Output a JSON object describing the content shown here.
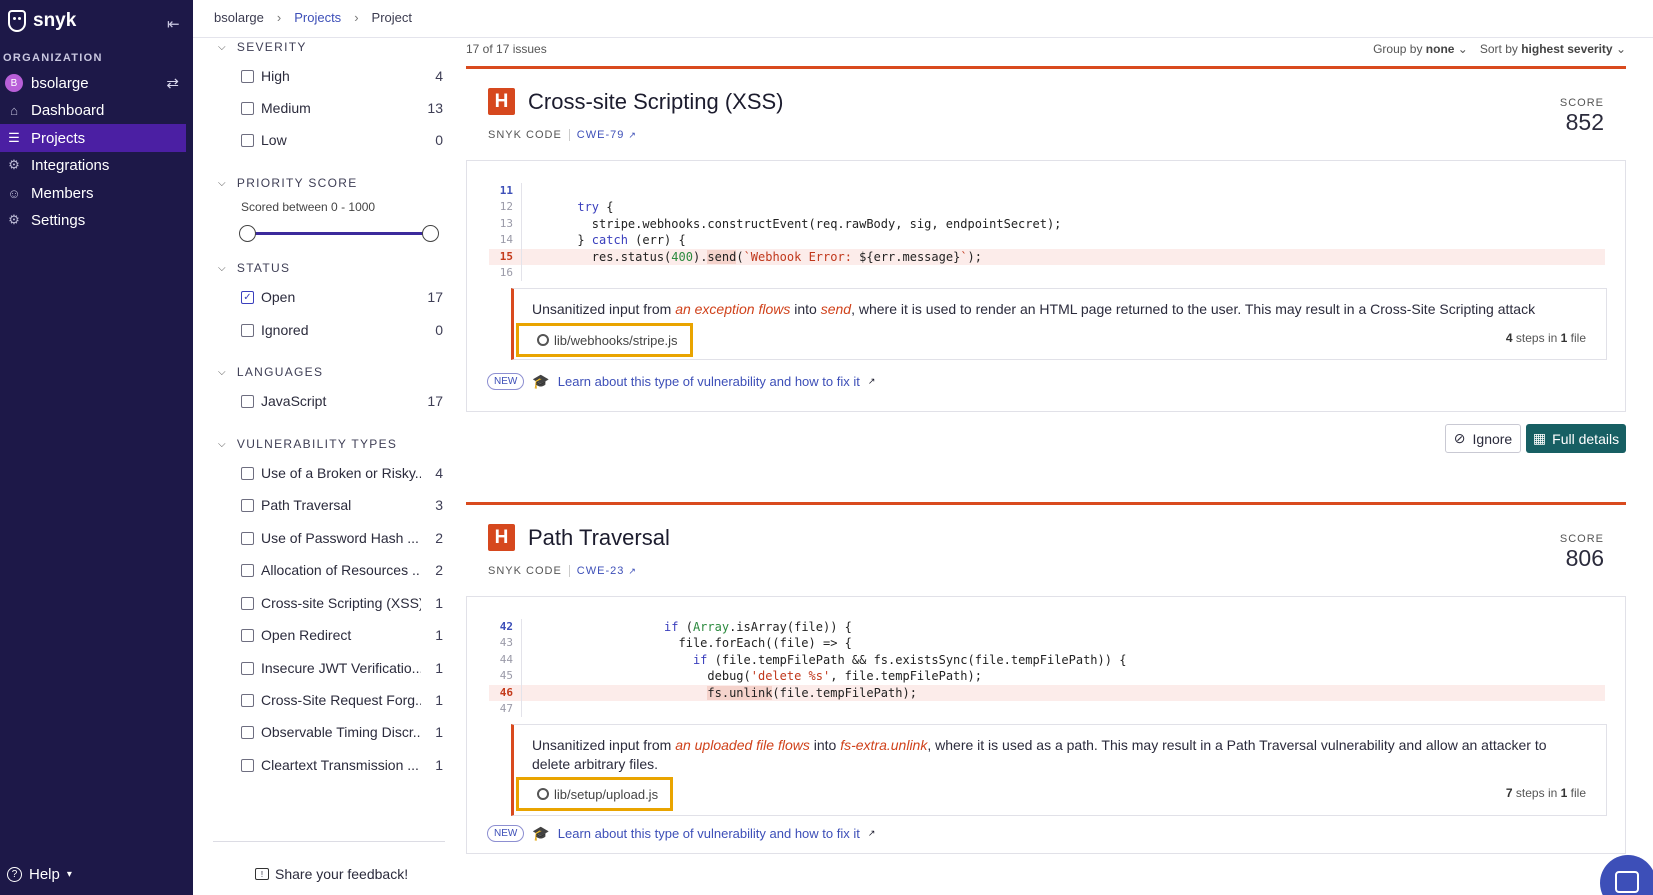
{
  "brand": "snyk",
  "nav": {
    "org_heading": "ORGANIZATION",
    "org_avatar": "B",
    "org_name": "bsolarge",
    "items": [
      {
        "label": "Dashboard",
        "icon": "home-icon"
      },
      {
        "label": "Projects",
        "icon": "projects-icon"
      },
      {
        "label": "Integrations",
        "icon": "integrations-icon"
      },
      {
        "label": "Members",
        "icon": "members-icon"
      },
      {
        "label": "Settings",
        "icon": "gear-icon"
      }
    ],
    "help": "Help"
  },
  "breadcrumb": [
    "bsolarge",
    "Projects",
    "Project"
  ],
  "filters": {
    "severity": {
      "heading": "SEVERITY",
      "items": [
        {
          "label": "High",
          "count": "4"
        },
        {
          "label": "Medium",
          "count": "13"
        },
        {
          "label": "Low",
          "count": "0"
        }
      ]
    },
    "priority": {
      "heading": "PRIORITY SCORE",
      "sub": "Scored between 0 - 1000",
      "range": [
        0,
        1000
      ],
      "selected": [
        0,
        1000
      ]
    },
    "status": {
      "heading": "STATUS",
      "items": [
        {
          "label": "Open",
          "count": "17",
          "checked": true
        },
        {
          "label": "Ignored",
          "count": "0"
        }
      ]
    },
    "languages": {
      "heading": "LANGUAGES",
      "items": [
        {
          "label": "JavaScript",
          "count": "17"
        }
      ]
    },
    "vuln_types": {
      "heading": "VULNERABILITY TYPES",
      "items": [
        {
          "label": "Use of a Broken or Risky...",
          "count": "4"
        },
        {
          "label": "Path Traversal",
          "count": "3"
        },
        {
          "label": "Use of Password Hash ...",
          "count": "2"
        },
        {
          "label": "Allocation of Resources ...",
          "count": "2"
        },
        {
          "label": "Cross-site Scripting (XSS)",
          "count": "1"
        },
        {
          "label": "Open Redirect",
          "count": "1"
        },
        {
          "label": "Insecure JWT Verificatio...",
          "count": "1"
        },
        {
          "label": "Cross-Site Request Forg...",
          "count": "1"
        },
        {
          "label": "Observable Timing Discr...",
          "count": "1"
        },
        {
          "label": "Cleartext Transmission ...",
          "count": "1"
        }
      ]
    },
    "feedback": "Share your feedback!"
  },
  "results": {
    "count": "17 of 17 issues",
    "group_label": "Group by",
    "group_value": "none",
    "sort_label": "Sort by",
    "sort_value": "highest severity"
  },
  "issues": [
    {
      "severity": "H",
      "title": "Cross-site Scripting (XSS)",
      "source": "SNYK CODE",
      "cwe": "CWE-79",
      "score_label": "SCORE",
      "score": "852",
      "code": [
        {
          "n": "11",
          "t": ""
        },
        {
          "n": "12",
          "t": "try {"
        },
        {
          "n": "13",
          "t": "stripe.webhooks.constructEvent(req.rawBody, sig, endpointSecret);"
        },
        {
          "n": "14",
          "t": "} catch (err) {"
        },
        {
          "n": "15",
          "t": "res.status(400).send(`Webhook Error: ${err.message}`);"
        },
        {
          "n": "16",
          "t": ""
        }
      ],
      "message_pre": "Unsanitized input from ",
      "message_src": "an exception flows",
      "message_mid": " into ",
      "message_sink": "send",
      "message_post": ", where it is used to render an HTML page returned to the user. This may result in a Cross-Site Scripting attack (XSS).",
      "file": "lib/webhooks/stripe.js",
      "steps_count": "4",
      "steps_mid": " steps in ",
      "files_count": "1",
      "steps_post": " file",
      "new_badge": "NEW",
      "learn": "Learn about this type of vulnerability and how to fix it",
      "ignore": "Ignore",
      "full_details": "Full details"
    },
    {
      "severity": "H",
      "title": "Path Traversal",
      "source": "SNYK CODE",
      "cwe": "CWE-23",
      "score_label": "SCORE",
      "score": "806",
      "code": [
        {
          "n": "42",
          "t": "if (Array.isArray(file)) {"
        },
        {
          "n": "43",
          "t": "file.forEach((file) => {"
        },
        {
          "n": "44",
          "t": "if (file.tempFilePath && fs.existsSync(file.tempFilePath)) {"
        },
        {
          "n": "45",
          "t": "debug('delete %s', file.tempFilePath);"
        },
        {
          "n": "46",
          "t": "fs.unlink(file.tempFilePath);"
        },
        {
          "n": "47",
          "t": ""
        }
      ],
      "message_pre": "Unsanitized input from ",
      "message_src": "an uploaded file flows",
      "message_mid": " into ",
      "message_sink": "fs-extra.unlink",
      "message_post": ", where it is used as a path. This may result in a Path Traversal vulnerability and allow an attacker to delete arbitrary files.",
      "file": "lib/setup/upload.js",
      "steps_count": "7",
      "steps_mid": " steps in ",
      "files_count": "1",
      "steps_post": " file",
      "new_badge": "NEW",
      "learn": "Learn about this type of vulnerability and how to fix it"
    }
  ]
}
